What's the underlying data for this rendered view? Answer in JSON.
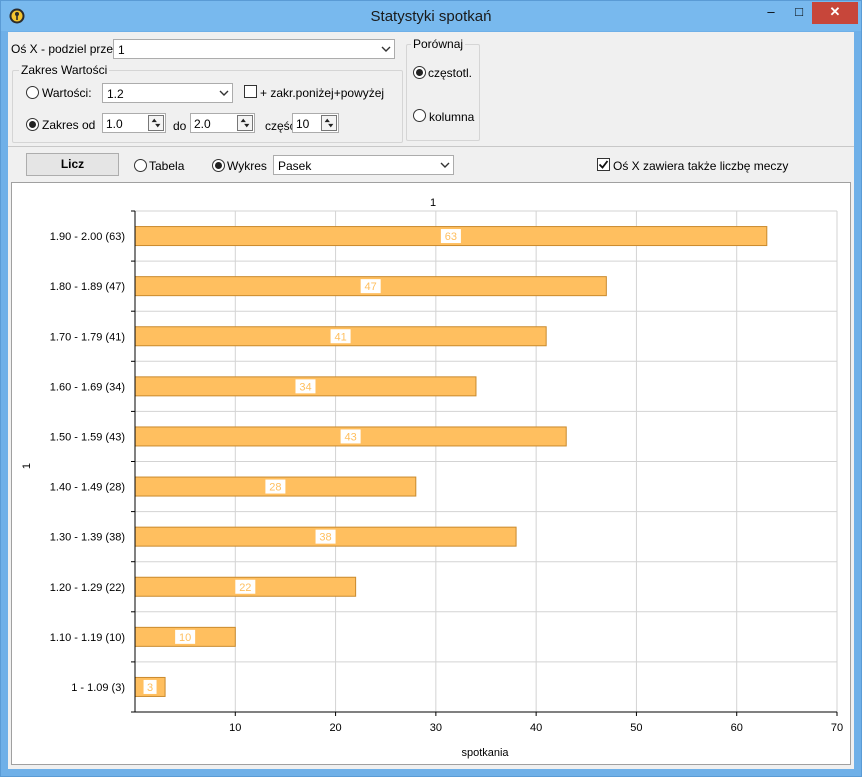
{
  "window": {
    "title": "Statystyki spotkań"
  },
  "controls": {
    "os_x_label": "Oś X - podziel przez",
    "os_x_value": "1",
    "zakres_title": "Zakres Wartości",
    "wartosci_label": "Wartości:",
    "wartosci_value": "1.2",
    "zakr_checkbox_label": "+ zakr.poniżej+powyżej",
    "zakres_od_label": "Zakres od",
    "zakres_od_value": "1.0",
    "do_label": "do",
    "do_value": "2.0",
    "czesc_label": "część",
    "czesc_value": "10",
    "porownaj_title": "Porównaj",
    "czestotl_label": "częstotl.",
    "kolumna_label": "kolumna",
    "licz_button": "Licz",
    "tabela_label": "Tabela",
    "wykres_label": "Wykres",
    "chart_type_value": "Pasek",
    "osx_checkbox_label": "Oś X zawiera także liczbę meczy"
  },
  "state": {
    "wartosci_selected": false,
    "zakres_od_selected": true,
    "zakr_checked": false,
    "czestotl_selected": true,
    "kolumna_selected": false,
    "tabela_selected": false,
    "wykres_selected": true,
    "osx_checked": true
  },
  "colors": {
    "bar_fill": "#FFBF5F",
    "bar_stroke": "#C98A2E",
    "grid": "#D3D3D3"
  },
  "icons": {
    "app": "key-shield-icon",
    "minimize": "minimize-icon",
    "maximize": "maximize-icon",
    "close": "close-icon"
  },
  "chart_data": {
    "type": "bar",
    "orientation": "horizontal",
    "title": "1",
    "xlabel": "spotkania",
    "ylabel": "1",
    "categories": [
      "1.90 - 2.00 (63)",
      "1.80 - 1.89 (47)",
      "1.70 - 1.79 (41)",
      "1.60 - 1.69 (34)",
      "1.50 - 1.59 (43)",
      "1.40 - 1.49 (28)",
      "1.30 - 1.39 (38)",
      "1.20 - 1.29 (22)",
      "1.10 - 1.19 (10)",
      "1 - 1.09 (3)"
    ],
    "values": [
      63,
      47,
      41,
      34,
      43,
      28,
      38,
      22,
      10,
      3
    ],
    "xlim": [
      0,
      70
    ],
    "xticks": [
      10,
      20,
      30,
      40,
      50,
      60,
      70
    ],
    "grid": true,
    "data_labels": true
  }
}
